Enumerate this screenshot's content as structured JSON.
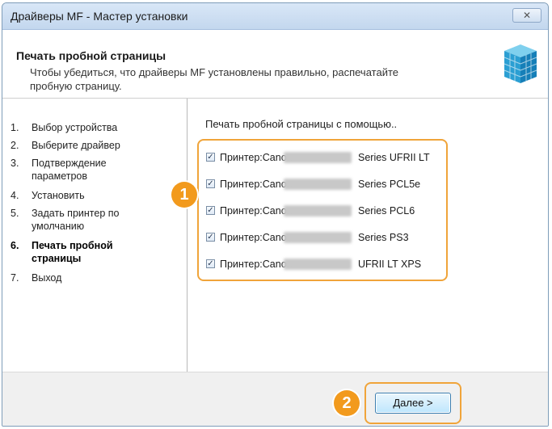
{
  "window": {
    "title": "Драйверы MF - Мастер установки",
    "close_label": "✕"
  },
  "header": {
    "title": "Печать пробной страницы",
    "description": "Чтобы убедиться, что драйверы MF установлены правильно, распечатайте пробную страницу."
  },
  "steps": [
    {
      "number": "1.",
      "label": "Выбор устройства",
      "active": false
    },
    {
      "number": "2.",
      "label": "Выберите драйвер",
      "active": false
    },
    {
      "number": "3.",
      "label": "Подтверждение параметров",
      "active": false
    },
    {
      "number": "4.",
      "label": "Установить",
      "active": false
    },
    {
      "number": "5.",
      "label": "Задать принтер по умолчанию",
      "active": false
    },
    {
      "number": "6.",
      "label": "Печать пробной страницы",
      "active": true
    },
    {
      "number": "7.",
      "label": "Выход",
      "active": false
    }
  ],
  "content": {
    "label": "Печать пробной страницы с помощью..",
    "printers": [
      {
        "prefix": "Принтер:Canon",
        "suffix": "Series UFRII LT",
        "checked": true,
        "check_glyph": "✓"
      },
      {
        "prefix": "Принтер:Canon",
        "suffix": "Series PCL5e",
        "checked": true,
        "check_glyph": "✓"
      },
      {
        "prefix": "Принтер:Canon",
        "suffix": "Series PCL6",
        "checked": true,
        "check_glyph": "✓"
      },
      {
        "prefix": "Принтер:Canon",
        "suffix": "Series PS3",
        "checked": true,
        "check_glyph": "✓"
      },
      {
        "prefix": "Принтер:Canon",
        "suffix": "UFRII LT XPS",
        "checked": true,
        "check_glyph": "✓"
      }
    ]
  },
  "callouts": {
    "one": "1",
    "two": "2"
  },
  "footer": {
    "next_label": "Далее >"
  },
  "colors": {
    "accent": "#f0a43a",
    "badge": "#f29a1d",
    "title_bar": "#c3d7ee"
  },
  "icons": {
    "close": "close-icon",
    "installer": "installer-box-icon",
    "checkbox": "checkmark-icon"
  }
}
